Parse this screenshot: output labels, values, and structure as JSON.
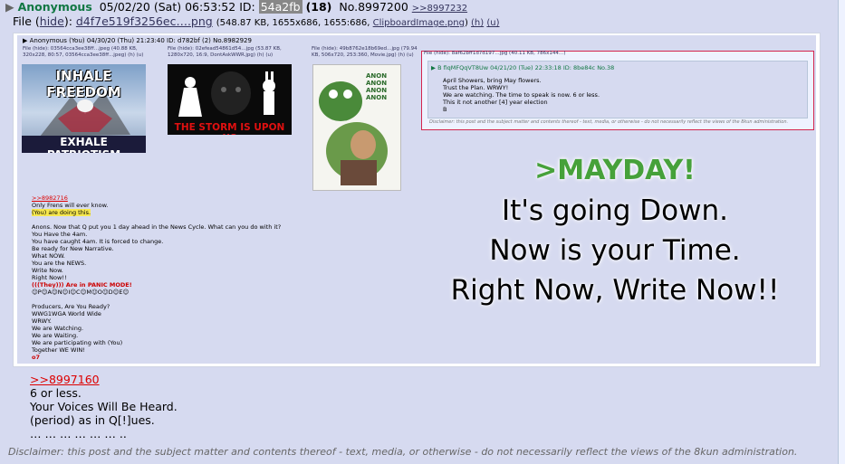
{
  "post": {
    "name": "Anonymous",
    "date": "05/02/20 (Sat) 06:53:52",
    "id_label": "ID:",
    "id": "54a2fb",
    "count": "(18)",
    "number": "No.8997200",
    "backlink": ">>8997232",
    "file_label": "File",
    "hide": "hide",
    "filename": "d4f7e519f3256ec….png",
    "file_meta": "(548.87 KB, 1655x686, 1655:686,",
    "orig_name": "ClipboardImage.png",
    "h": "(h)",
    "u": "(u)",
    "quote": ">>8997160",
    "lines": [
      "6 or less.",
      "Your Voices Will Be Heard.",
      "(period) as in Q[!]ues.",
      "… … … … … … .."
    ],
    "disclaimer": "Disclaimer: this post and the subject matter and contents thereof - text, media, or otherwise - do not necessarily reflect the views of the 8kun administration."
  },
  "screenshot": {
    "header": "▶ Anonymous (You) 04/30/20 (Thu) 21:23:40 ID: d782bf (2) No.8982929",
    "files": [
      {
        "label": "File (hide): 03564cca3ee38ff…jpeg (40.88 KB, 320x228, 80:57, 03564cca3ee38ff...jpeg) (h) (u)",
        "caption": "INHALE FREEDOM / EXHALE PATRIOTISM"
      },
      {
        "label": "File (hide): 02efead54861d54…jpg (53.87 KB, 1280x720, 16:9, DontAskWWR.jpg) (h) (u)",
        "caption": "THE STORM IS UPON US"
      },
      {
        "label": "File (hide): 49b8762e18b69ed…jpg (79.94 KB, 506x720, 253:360, Movie.jpg) (h) (u)",
        "caption": "ANON ANON ANON ANON"
      }
    ],
    "quoted": {
      "header": "▶ B fiqMFQqVT8Uw 04/21/20 (Tue) 22:33:18 ID: 8be84c No.38",
      "lines": [
        "April Showers, bring May flowers.",
        "Trust the Plan. WRWY!",
        "We are watching. The time to speak is now. 6 or less.",
        "This it not another [4] year election",
        "B"
      ],
      "disclaimer": "Disclaimer: this post and the subject matter and contents thereof - text, media, or otherwise - do not necessarily reflect the views of the 8kun administration."
    },
    "body_lines": [
      ">>8982716",
      "Only Frens will ever know.",
      "(You) are doing this.",
      "",
      "Anons. Now that Q put you 1 day ahead in the News Cycle. What can you do with it?",
      "You Have the 4am.",
      "You have caught 4am. It is forced to change.",
      "Be ready for New Narrative.",
      "What NOW.",
      "You are the NEWS.",
      "Write Now.",
      "Right Now!!",
      "(((They))) Are in PANIC MODE!",
      "☺P☺A☺N☺I☺C☺M☺O☺D☺E☺",
      "",
      "Producers, Are You Ready?",
      "WWG1WGA World Wide",
      "WRWY.",
      "We are Watching.",
      "We are Waiting.",
      "We are participating with (You)",
      "Together WE WIN!",
      "o7"
    ],
    "meme": {
      "mayday": ">MAYDAY!",
      "line1": "It's going Down.",
      "line2": "Now is your Time.",
      "line3": "Right Now, Write Now!!"
    }
  }
}
